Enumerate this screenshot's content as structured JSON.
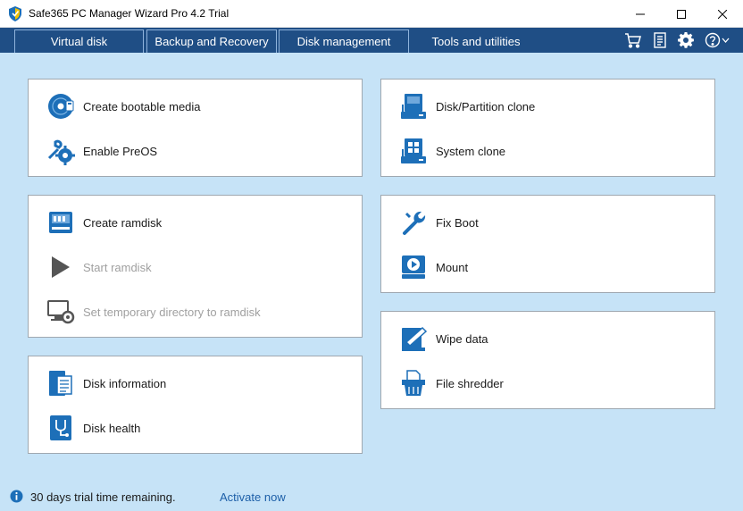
{
  "window": {
    "title": "Safe365 PC Manager Wizard Pro 4.2 Trial"
  },
  "tabs": [
    {
      "label": "Virtual disk"
    },
    {
      "label": "Backup and Recovery"
    },
    {
      "label": "Disk management"
    },
    {
      "label": "Tools and utilities"
    }
  ],
  "panels": {
    "bootable": {
      "items": [
        {
          "label": "Create bootable media",
          "icon": "boot-disc-icon"
        },
        {
          "label": "Enable PreOS",
          "icon": "preos-gear-icon"
        }
      ]
    },
    "ramdisk": {
      "items": [
        {
          "label": "Create ramdisk",
          "icon": "ramdisk-icon"
        },
        {
          "label": "Start ramdisk",
          "icon": "play-icon"
        },
        {
          "label": "Set temporary directory to ramdisk",
          "icon": "monitor-gear-icon"
        }
      ]
    },
    "diskinfo": {
      "items": [
        {
          "label": "Disk information",
          "icon": "disk-info-icon"
        },
        {
          "label": "Disk health",
          "icon": "disk-health-icon"
        }
      ]
    },
    "clone": {
      "items": [
        {
          "label": "Disk/Partition clone",
          "icon": "disk-clone-icon"
        },
        {
          "label": "System clone",
          "icon": "system-clone-icon"
        }
      ]
    },
    "repair": {
      "items": [
        {
          "label": "Fix Boot",
          "icon": "wrench-icon"
        },
        {
          "label": "Mount",
          "icon": "mount-icon"
        }
      ]
    },
    "erase": {
      "items": [
        {
          "label": "Wipe data",
          "icon": "wipe-data-icon"
        },
        {
          "label": "File shredder",
          "icon": "shredder-icon"
        }
      ]
    }
  },
  "status": {
    "text": "30 days trial time remaining.",
    "link": "Activate now"
  },
  "colors": {
    "tabstrip": "#1f4e85",
    "content_bg": "#c6e3f7",
    "icon_blue": "#1d6fb8",
    "link": "#1d5fa8"
  }
}
